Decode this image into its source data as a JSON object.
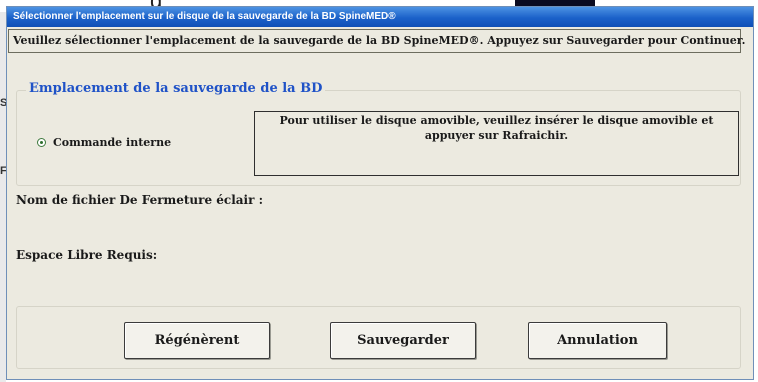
{
  "background": {
    "cut_text": "g",
    "left_letters": [
      "S",
      "F"
    ]
  },
  "dialog": {
    "title": "Sélectionner l'emplacement sur le disque de la sauvegarde de la BD SpineMED®",
    "instruction": "Veuillez sélectionner l'emplacement de la sauvegarde de la BD SpineMED®. Appuyez sur Sauvegarder pour Continuer.",
    "group_title": "Emplacement de la sauvegarde de la BD",
    "radio_option": {
      "label": "Commande interne",
      "selected": true
    },
    "removable_note": "Pour utiliser le disque amovible, veuillez insérer le disque amovible et appuyer sur Rafraichir.",
    "zip_filename_label": "Nom de fichier De Fermeture éclair :",
    "free_space_label": "Espace Libre Requis:",
    "buttons": {
      "refresh": "Régénèrent",
      "save": "Sauvegarder",
      "cancel": "Annulation"
    }
  },
  "colors": {
    "title_bar": "#1b61c9",
    "group_title": "#1f52c7",
    "window_bg": "#eceae0"
  }
}
